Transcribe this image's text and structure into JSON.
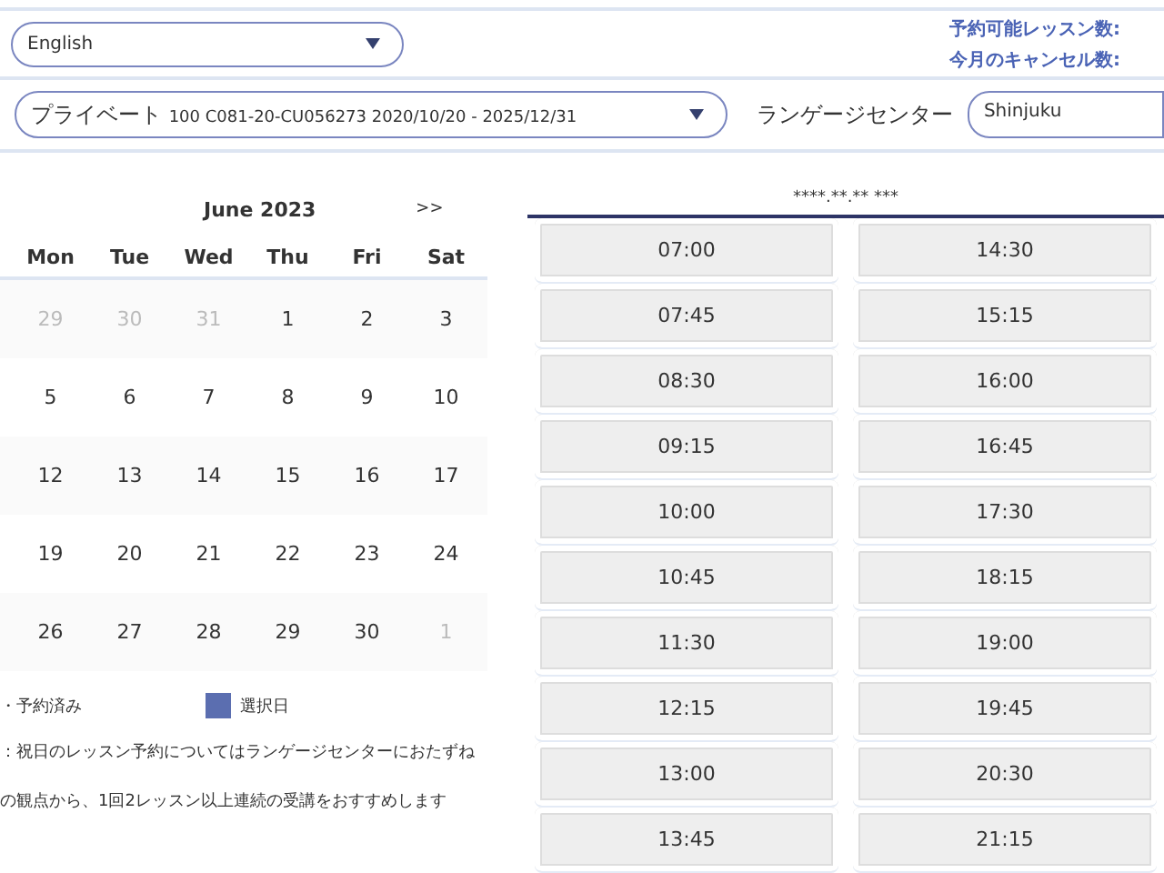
{
  "language_select": {
    "value": "English"
  },
  "lesson_counts": [
    "予約可能レッスン数:",
    "今月のキャンセル数:"
  ],
  "contract_select": {
    "value_main": "プライベート",
    "value_detail": "100 C081-20-CU056273 2020/10/20 - 2025/12/31"
  },
  "center": {
    "label": "ランゲージセンター",
    "value": "Shinjuku"
  },
  "calendar": {
    "title": "June 2023",
    "next": ">>",
    "weekdays": [
      "Mon",
      "Tue",
      "Wed",
      "Thu",
      "Fri",
      "Sat"
    ],
    "weeks": [
      [
        {
          "day": "29",
          "other_month": true
        },
        {
          "day": "30",
          "other_month": true
        },
        {
          "day": "31",
          "other_month": true
        },
        {
          "day": "1",
          "other_month": false
        },
        {
          "day": "2",
          "other_month": false
        },
        {
          "day": "3",
          "other_month": false
        }
      ],
      [
        {
          "day": "5",
          "other_month": false
        },
        {
          "day": "6",
          "other_month": false
        },
        {
          "day": "7",
          "other_month": false
        },
        {
          "day": "8",
          "other_month": false
        },
        {
          "day": "9",
          "other_month": false
        },
        {
          "day": "10",
          "other_month": false
        }
      ],
      [
        {
          "day": "12",
          "other_month": false
        },
        {
          "day": "13",
          "other_month": false
        },
        {
          "day": "14",
          "other_month": false
        },
        {
          "day": "15",
          "other_month": false
        },
        {
          "day": "16",
          "other_month": false
        },
        {
          "day": "17",
          "other_month": false
        }
      ],
      [
        {
          "day": "19",
          "other_month": false
        },
        {
          "day": "20",
          "other_month": false
        },
        {
          "day": "21",
          "other_month": false
        },
        {
          "day": "22",
          "other_month": false
        },
        {
          "day": "23",
          "other_month": false
        },
        {
          "day": "24",
          "other_month": false
        }
      ],
      [
        {
          "day": "26",
          "other_month": false
        },
        {
          "day": "27",
          "other_month": false
        },
        {
          "day": "28",
          "other_month": false
        },
        {
          "day": "29",
          "other_month": false
        },
        {
          "day": "30",
          "other_month": false
        },
        {
          "day": "1",
          "other_month": true
        }
      ]
    ]
  },
  "legend": [
    {
      "label": "・予約済み"
    },
    {
      "label": "選択日",
      "color": "#5b6eb0"
    }
  ],
  "notes": [
    "：祝日のレッスン予約についてはランゲージセンターにおたずね",
    "の観点から、1回2レッスン以上連続の受講をおすすめします"
  ],
  "slots_header": "****.**.** ***",
  "slot_columns": [
    [
      "07:00",
      "07:45",
      "08:30",
      "09:15",
      "10:00",
      "10:45",
      "11:30",
      "12:15",
      "13:00",
      "13:45"
    ],
    [
      "14:30",
      "15:15",
      "16:00",
      "16:45",
      "17:30",
      "18:15",
      "19:00",
      "19:45",
      "20:30",
      "21:15"
    ]
  ]
}
